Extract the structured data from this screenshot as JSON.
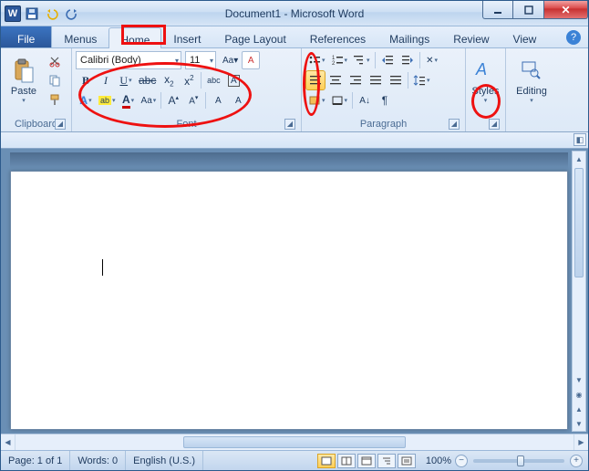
{
  "title": "Document1 - Microsoft Word",
  "tabs": {
    "file": "File",
    "menus": "Menus",
    "home": "Home",
    "insert": "Insert",
    "page_layout": "Page Layout",
    "references": "References",
    "mailings": "Mailings",
    "review": "Review",
    "view": "View"
  },
  "ribbon": {
    "clipboard": {
      "label": "Clipboard",
      "paste": "Paste"
    },
    "font": {
      "label": "Font",
      "family": "Calibri (Body)",
      "size": "11"
    },
    "paragraph": {
      "label": "Paragraph"
    },
    "styles": {
      "label": "Styles"
    },
    "editing": {
      "label": "Editing"
    }
  },
  "status": {
    "page": "Page: 1 of 1",
    "words": "Words: 0",
    "lang": "English (U.S.)",
    "zoom": "100%"
  }
}
